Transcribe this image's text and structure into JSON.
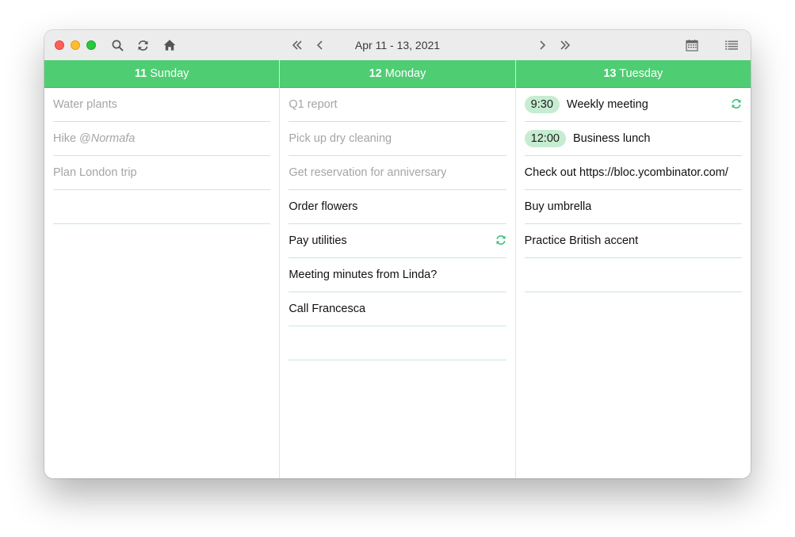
{
  "toolbar": {
    "date_range": "Apr 11 - 13, 2021",
    "icons": [
      "search-icon",
      "refresh-icon",
      "home-icon",
      "double-chevron-left-icon",
      "chevron-left-icon",
      "chevron-right-icon",
      "double-chevron-right-icon",
      "calendar-icon",
      "list-icon"
    ]
  },
  "colors": {
    "header_green": "#4fcd73",
    "time_badge": "#c6ecd1",
    "repeat_icon": "#35c07a",
    "done_text": "#a5a5a5"
  },
  "columns": [
    {
      "day_number": "11",
      "day_name": "Sunday",
      "tasks": [
        {
          "text": "Water plants",
          "done": true
        },
        {
          "text": "Hike @",
          "text_italic": "Normafa",
          "done": true
        },
        {
          "text": "Plan London trip",
          "done": true
        },
        {
          "text": "",
          "done": false
        }
      ]
    },
    {
      "day_number": "12",
      "day_name": "Monday",
      "tasks": [
        {
          "text": "Q1 report",
          "done": true
        },
        {
          "text": "Pick up dry cleaning",
          "done": true
        },
        {
          "text": "Get reservation for anniversary",
          "done": true
        },
        {
          "text": "Order flowers",
          "done": false
        },
        {
          "text": "Pay utilities",
          "done": false,
          "repeat": true
        },
        {
          "text": "Meeting minutes from Linda?",
          "done": false
        },
        {
          "text": "Call Francesca",
          "done": false
        },
        {
          "text": "",
          "done": false
        }
      ]
    },
    {
      "day_number": "13",
      "day_name": "Tuesday",
      "tasks": [
        {
          "time": "9:30",
          "text": "Weekly meeting",
          "done": false,
          "repeat": true
        },
        {
          "time": "12:00",
          "text": "Business lunch",
          "done": false
        },
        {
          "text": "Check out https://bloc.ycombinator.com/",
          "done": false
        },
        {
          "text": "Buy umbrella",
          "done": false
        },
        {
          "text": "Practice British accent",
          "done": false
        },
        {
          "text": "",
          "done": false
        }
      ]
    }
  ]
}
